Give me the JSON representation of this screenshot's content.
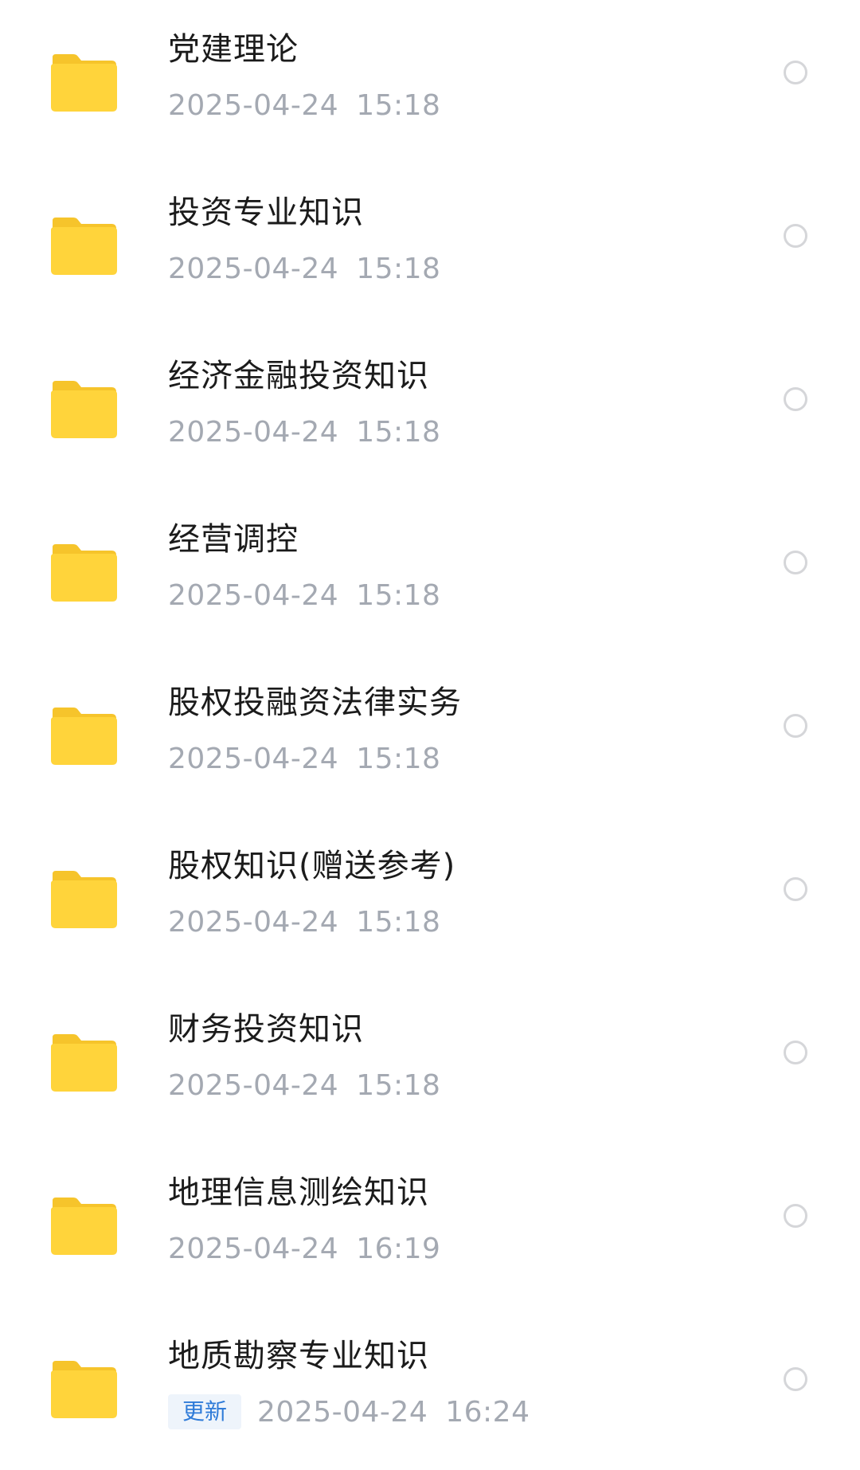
{
  "colors": {
    "folder_body": "#FFD43B",
    "folder_tab": "#F6C42B",
    "title_text": "#1b1b1b",
    "meta_text": "#a4a9b2",
    "badge_bg": "#eef4fb",
    "badge_text": "#2f7bd8",
    "radio_border": "#d5d6d9"
  },
  "icons": {
    "folder": "folder-icon",
    "select": "radio-circle-icon"
  },
  "items": [
    {
      "name": "党建理论",
      "date": "2025-04-24",
      "time": "15:18",
      "badge": ""
    },
    {
      "name": "投资专业知识",
      "date": "2025-04-24",
      "time": "15:18",
      "badge": ""
    },
    {
      "name": "经济金融投资知识",
      "date": "2025-04-24",
      "time": "15:18",
      "badge": ""
    },
    {
      "name": "经营调控",
      "date": "2025-04-24",
      "time": "15:18",
      "badge": ""
    },
    {
      "name": "股权投融资法律实务",
      "date": "2025-04-24",
      "time": "15:18",
      "badge": ""
    },
    {
      "name": "股权知识(赠送参考)",
      "date": "2025-04-24",
      "time": "15:18",
      "badge": ""
    },
    {
      "name": "财务投资知识",
      "date": "2025-04-24",
      "time": "15:18",
      "badge": ""
    },
    {
      "name": "地理信息测绘知识",
      "date": "2025-04-24",
      "time": "16:19",
      "badge": ""
    },
    {
      "name": "地质勘察专业知识",
      "date": "2025-04-24",
      "time": "16:24",
      "badge": "更新"
    }
  ]
}
